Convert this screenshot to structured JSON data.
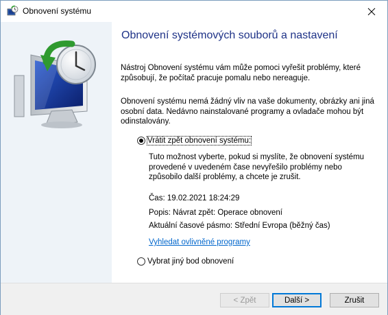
{
  "window": {
    "title": "Obnovení systému"
  },
  "page": {
    "heading": "Obnovení systémových souborů a nastavení",
    "intro": "Nástroj Obnovení systému vám může pomoci vyřešit problémy, které způsobují, že počítač pracuje pomalu nebo nereaguje.",
    "note": "Obnovení systému nemá žádný vliv na vaše dokumenty, obrázky ani jiná osobní data. Nedávno nainstalované programy a ovladače mohou být odinstalovány."
  },
  "options": {
    "undo": {
      "label": "Vrátit zpět obnovení systému:",
      "selected": true,
      "description": "Tuto možnost vyberte, pokud si myslíte, že obnovení systému provedené v uvedeném čase nevyřešilo problémy nebo způsobilo další problémy, a chcete je zrušit.",
      "time": "Čas: 19.02.2021 18:24:29",
      "popis": "Popis: Návrat zpět: Operace obnovení",
      "timezone": "Aktuální časové pásmo: Střední Evropa (běžný čas)",
      "link": "Vyhledat ovlivněné programy"
    },
    "other": {
      "label": "Vybrat jiný bod obnovení",
      "selected": false
    }
  },
  "buttons": {
    "back": "< Zpět",
    "next": "Další >",
    "cancel": "Zrušit"
  }
}
